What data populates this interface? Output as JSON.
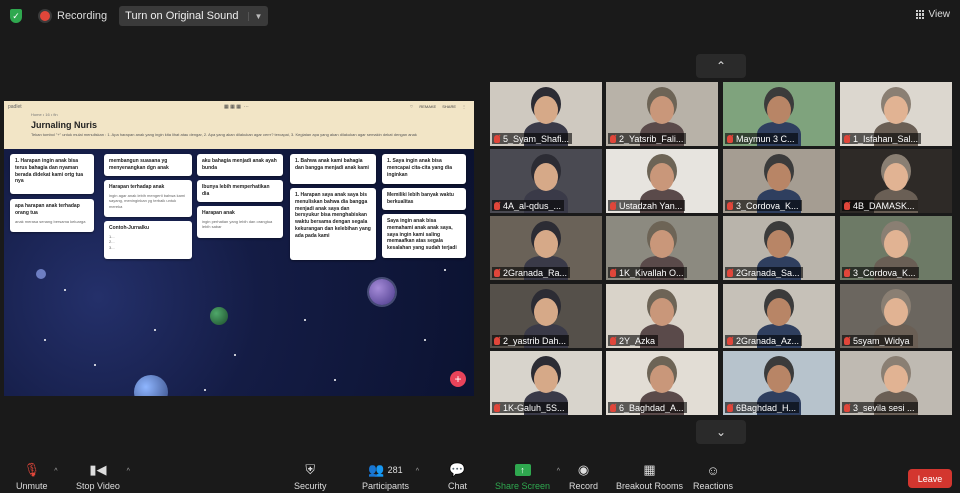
{
  "topbar": {
    "recording_label": "Recording",
    "original_sound_label": "Turn on Original Sound",
    "view_label": "View"
  },
  "padlet": {
    "logo": "padlet",
    "breadcrumb": "Home • 16 • fin",
    "title": "Jurnaling Nuris",
    "description": "Tekan tombol \"+\" untuk mulai menuliskan : 1. Apa harapan anak yang ingin kita lihat atau dengar, 2. Apa yang akan dilakukan agar cerrr? tercapai, 3. Kegiatan apa yang akan dilakukan agar semakin dekat dengan anak",
    "tools_right": [
      "REMAKE",
      "SHARE"
    ],
    "cards": [
      {
        "title": "1. Harapan ingin anak bisa terus bahagia dan nyaman berada didekat kami ortg tua nya",
        "sub": ""
      },
      {
        "title": "apa harapan anak terhadap orang tua",
        "sub": "anak merasa senang bersama keluarga"
      },
      {
        "title": "membangun suasana yg menyenangkan dgn anak",
        "sub": ""
      },
      {
        "title": "Harapan terhadap anak",
        "sub": "ingin agar anak lebih mengerti bahwa kami sayang, meninginkan yg terbaik untuk mereka"
      },
      {
        "title": "Contoh-Jurnalku",
        "sub": "1...\n2...\n3..."
      },
      {
        "title": "aku bahagia menjadi anak ayah bunda",
        "sub": ""
      },
      {
        "title": "Ibunya lebih memperhatikan dia",
        "sub": ""
      },
      {
        "title": "Harapan anak",
        "sub": "ingin perhatian yang lebih dan orangtua lebih sabar"
      },
      {
        "title": "1. Bahwa anak kami bahagia dan bangga menjadi anak kami",
        "sub": ""
      },
      {
        "title": "1. Harapan saya anak saya bis menuliskan bahwa dia bangga menjadi anak saya dan bersyukur bisa menghabiskan waktu bersama dengan segala kekurangan dan kelebihan yang ada pada kami",
        "sub": ""
      },
      {
        "title": "1. Saya ingin anak bisa mencapai cita-cita yang dia inginkan",
        "sub": ""
      },
      {
        "title": "Memiliki lebih banyak waktu berkualitas",
        "sub": ""
      },
      {
        "title": "Saya ingin anak bisa memahami anak anak saya, saya ingin kami saling memaafkan atas segala kesalahan yang sudah terjadi",
        "sub": ""
      }
    ],
    "fab": "+"
  },
  "gallery": {
    "up_arrow": "⌃",
    "down_arrow": "⌄",
    "tiles": [
      {
        "name": "5_Syam_Shafi..."
      },
      {
        "name": "2_Yatsrib_Fali..."
      },
      {
        "name": "Maymun 3 C..."
      },
      {
        "name": "1_Isfahan_Sal..."
      },
      {
        "name": "4A_al-qdus_..."
      },
      {
        "name": "Ustadzah Yan..."
      },
      {
        "name": "3_Cordova_K..."
      },
      {
        "name": "4B_DAMASK..."
      },
      {
        "name": "2Granada_Ra..."
      },
      {
        "name": "1K_Kivallah O..."
      },
      {
        "name": "2Granada_Sa..."
      },
      {
        "name": "3_Cordova_K..."
      },
      {
        "name": "2_yastrib Dah..."
      },
      {
        "name": "2Y_Azka"
      },
      {
        "name": "2Granada_Az..."
      },
      {
        "name": "5syam_Widya"
      },
      {
        "name": "1K-Galuh_5S..."
      },
      {
        "name": "6_Baghdad_A..."
      },
      {
        "name": "6Baghdad_H..."
      },
      {
        "name": "3_sevila sesi ..."
      }
    ]
  },
  "toolbar": {
    "unmute": "Unmute",
    "stop_video": "Stop Video",
    "security": "Security",
    "participants": "Participants",
    "participants_count": "281",
    "chat": "Chat",
    "share_screen": "Share Screen",
    "record": "Record",
    "breakout": "Breakout Rooms",
    "reactions": "Reactions",
    "leave": "Leave"
  },
  "colors": {
    "accent_green": "#2fa84f",
    "leave_red": "#d3362f",
    "muted_red": "#e0463a"
  }
}
